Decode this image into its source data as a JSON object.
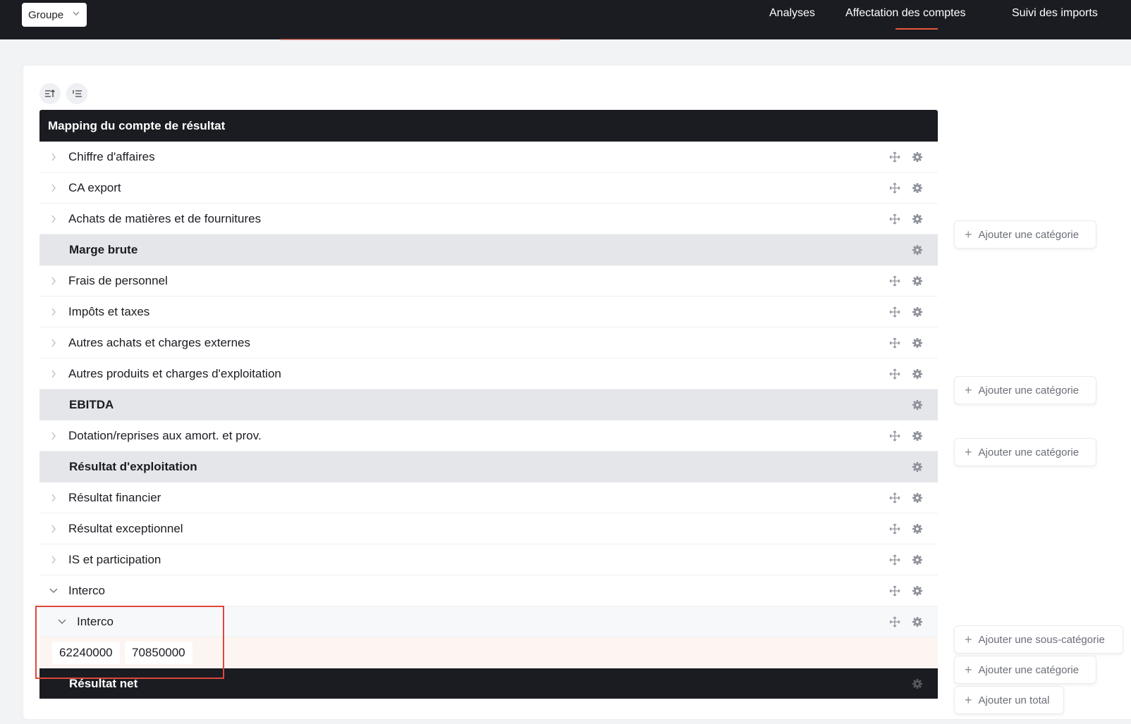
{
  "topbar": {
    "group_select": "Groupe",
    "nav": [
      "Analyses",
      "Affectation des comptes",
      "Suivi des imports"
    ],
    "active_nav": "Affectation des comptes"
  },
  "table": {
    "title": "Mapping du compte de résultat",
    "rows": [
      {
        "type": "category",
        "label": "Chiffre d'affaires"
      },
      {
        "type": "category",
        "label": "CA export"
      },
      {
        "type": "category",
        "label": "Achats de matières et de fournitures"
      },
      {
        "type": "total",
        "label": "Marge brute"
      },
      {
        "type": "category",
        "label": "Frais de personnel"
      },
      {
        "type": "category",
        "label": "Impôts et taxes"
      },
      {
        "type": "category",
        "label": "Autres achats et charges externes"
      },
      {
        "type": "category",
        "label": "Autres produits et charges d'exploitation"
      },
      {
        "type": "total",
        "label": "EBITDA"
      },
      {
        "type": "category",
        "label": "Dotation/reprises aux amort. et prov."
      },
      {
        "type": "total",
        "label": "Résultat d'exploitation"
      },
      {
        "type": "category",
        "label": "Résultat financier"
      },
      {
        "type": "category",
        "label": "Résultat exceptionnel"
      },
      {
        "type": "category",
        "label": "IS et participation"
      },
      {
        "type": "category-expanded",
        "label": "Interco"
      },
      {
        "type": "subcategory-expanded",
        "label": "Interco"
      }
    ],
    "account_codes": [
      "62240000",
      "70850000"
    ],
    "final_row": "Résultat net"
  },
  "side_actions": {
    "add_category": "Ajouter une catégorie",
    "add_subcategory": "Ajouter une sous-catégorie",
    "add_total": "Ajouter un total"
  },
  "colors": {
    "dark": "#1b1c22",
    "accent": "#e8563d",
    "total_row_bg": "#e4e6ea",
    "highlight_border": "#e0473b"
  },
  "icons": {
    "row_expand": "chevron-right-icon",
    "row_expanded": "chevron-down-icon",
    "drag": "move-icon",
    "settings": "gear-icon",
    "add": "plus-icon",
    "sort_toolbar": [
      "sort-icon",
      "ordered-list-icon"
    ]
  }
}
